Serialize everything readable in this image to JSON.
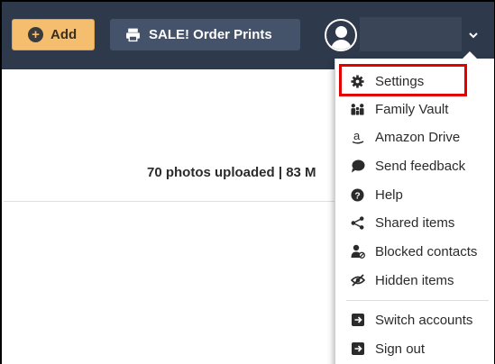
{
  "toolbar": {
    "add_label": "Add",
    "sale_label": "SALE! Order Prints"
  },
  "content": {
    "status_text": "70 photos uploaded | 83 M"
  },
  "menu": {
    "items": [
      {
        "label": "Settings",
        "icon": "gear-icon"
      },
      {
        "label": "Family Vault",
        "icon": "family-icon"
      },
      {
        "label": "Amazon Drive",
        "icon": "amazon-icon"
      },
      {
        "label": "Send feedback",
        "icon": "feedback-icon"
      },
      {
        "label": "Help",
        "icon": "help-icon"
      },
      {
        "label": "Shared items",
        "icon": "share-icon"
      },
      {
        "label": "Blocked contacts",
        "icon": "blocked-contact-icon"
      },
      {
        "label": "Hidden items",
        "icon": "hidden-eye-icon"
      },
      {
        "label": "Switch accounts",
        "icon": "switch-icon"
      },
      {
        "label": "Sign out",
        "icon": "sign-out-icon"
      }
    ],
    "highlighted": "Settings"
  },
  "colors": {
    "topbar": "#2e3a4c",
    "add_button": "#f5be6e",
    "sale_button": "#44526a",
    "highlight": "#e30000"
  }
}
